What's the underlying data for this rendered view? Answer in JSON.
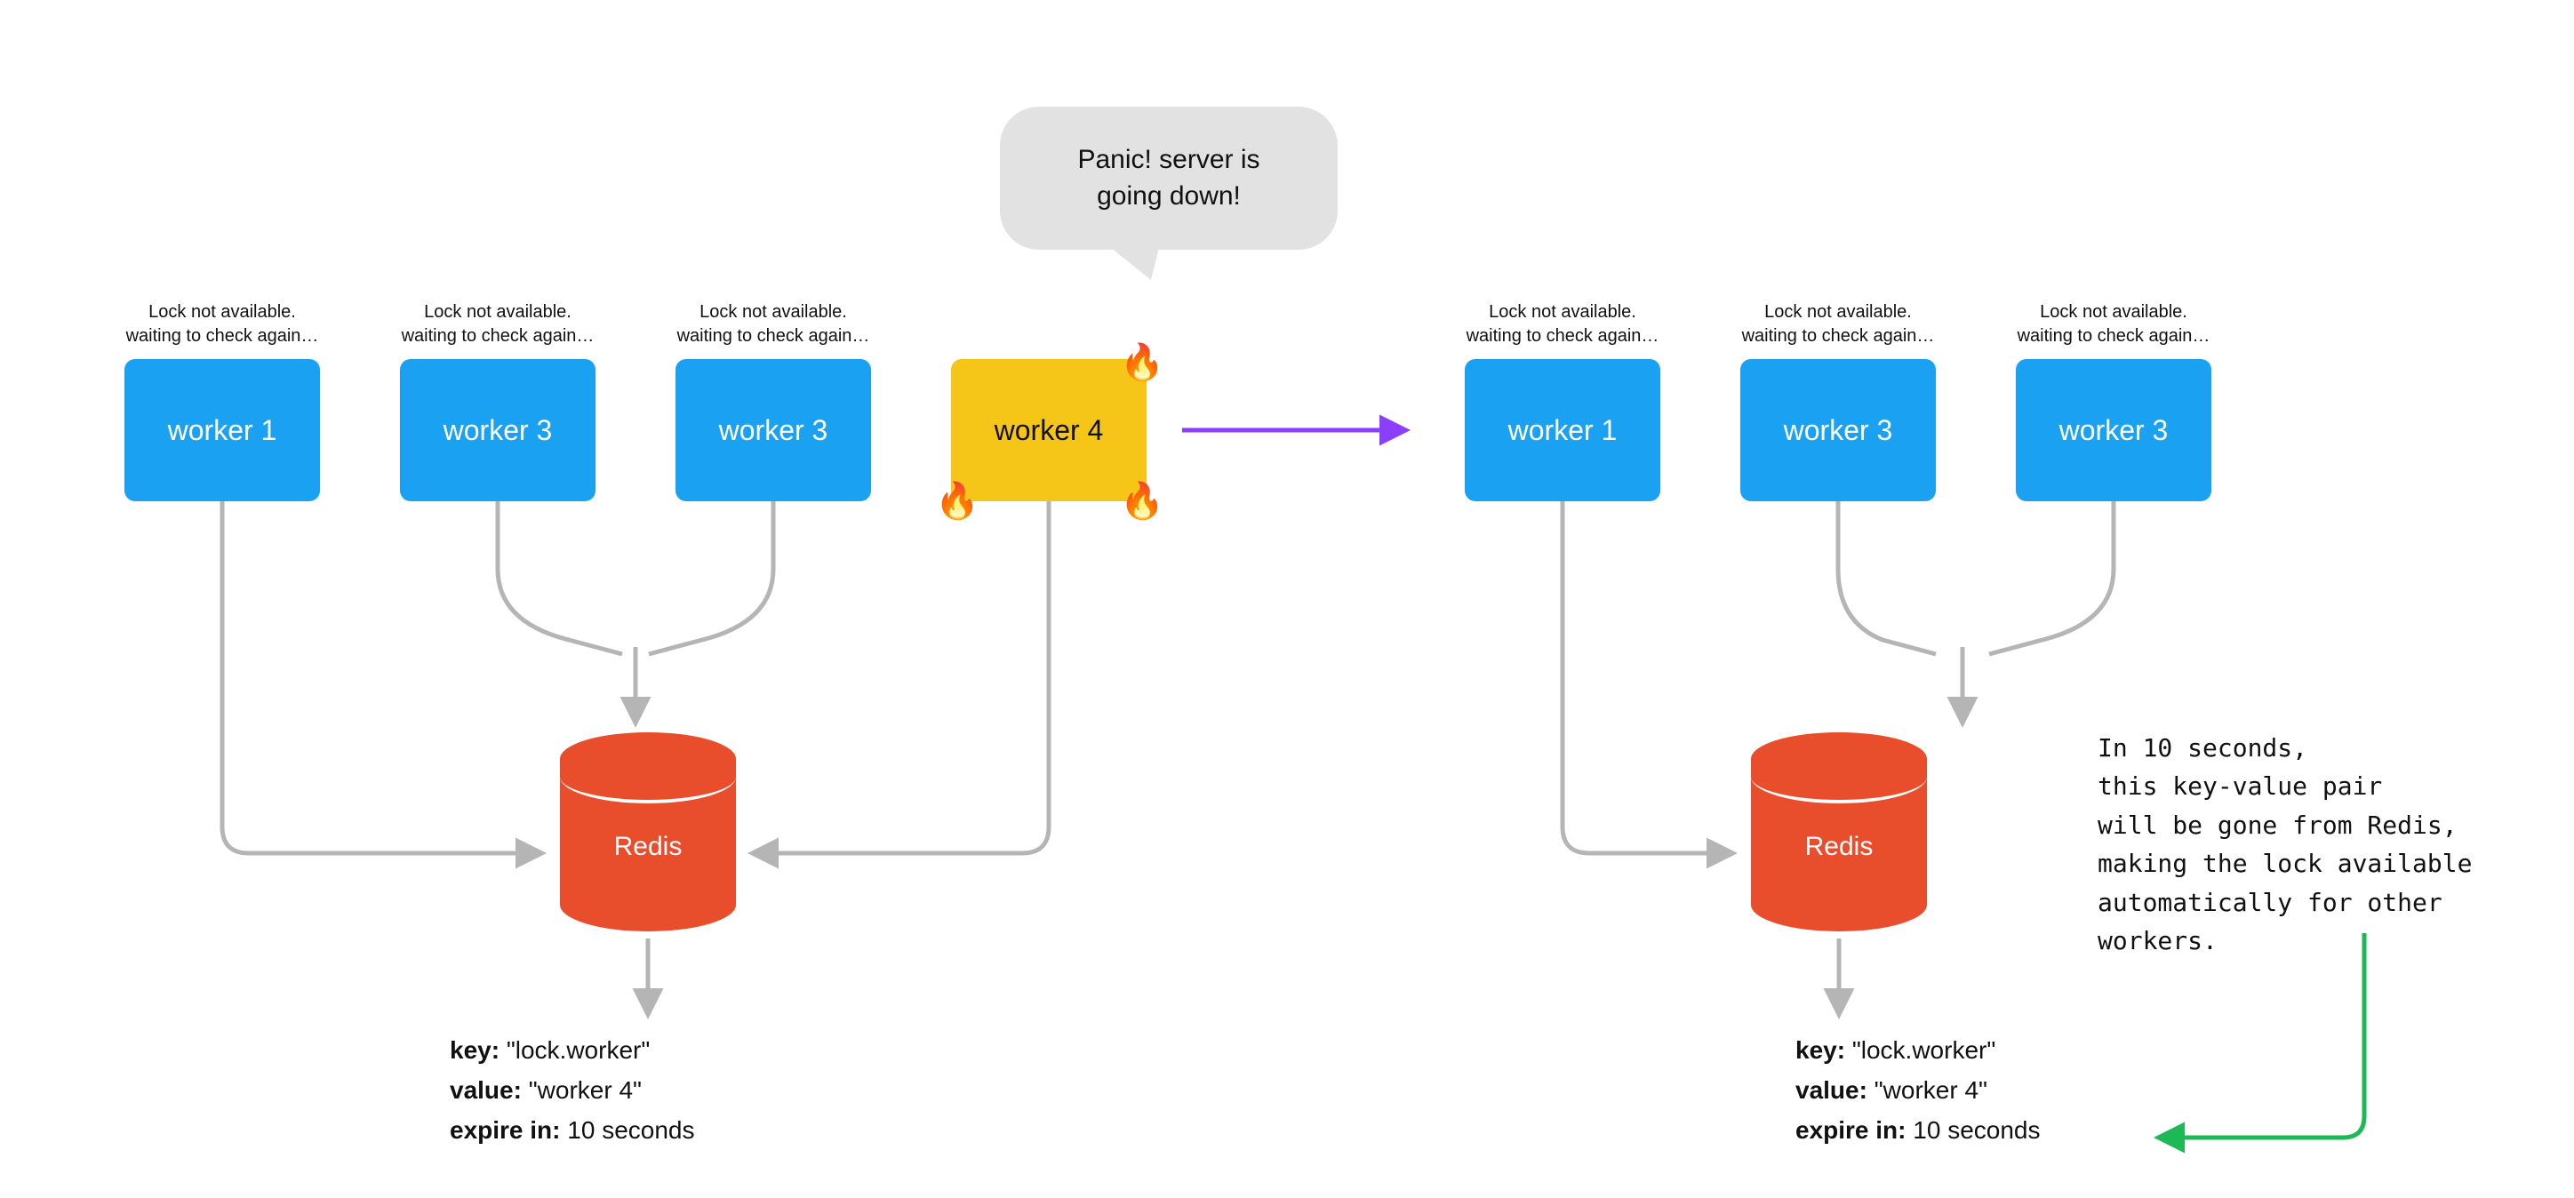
{
  "status_line1": "Lock not available.",
  "status_line2": "waiting to check again…",
  "speech_line1": "Panic! server is",
  "speech_line2": "going down!",
  "workers_left": [
    {
      "label": "worker 1"
    },
    {
      "label": "worker 3"
    },
    {
      "label": "worker 3"
    },
    {
      "label": "worker 4"
    }
  ],
  "workers_right": [
    {
      "label": "worker 1"
    },
    {
      "label": "worker 3"
    },
    {
      "label": "worker 3"
    }
  ],
  "redis_label": "Redis",
  "kv": {
    "key_label": "key:",
    "key_value": "\"lock.worker\"",
    "value_label": "value:",
    "value_value": "\"worker 4\"",
    "expire_label": "expire in:",
    "expire_value": "10 seconds"
  },
  "explanation": {
    "l1": "In 10 seconds,",
    "l2": "this key-value pair",
    "l3": "will be gone from Redis,",
    "l4": "making the lock available",
    "l5": "automatically for other workers."
  },
  "colors": {
    "arrow_gray": "#B5B5B5",
    "arrow_purple": "#8A3FFC",
    "arrow_green": "#1DB954"
  }
}
